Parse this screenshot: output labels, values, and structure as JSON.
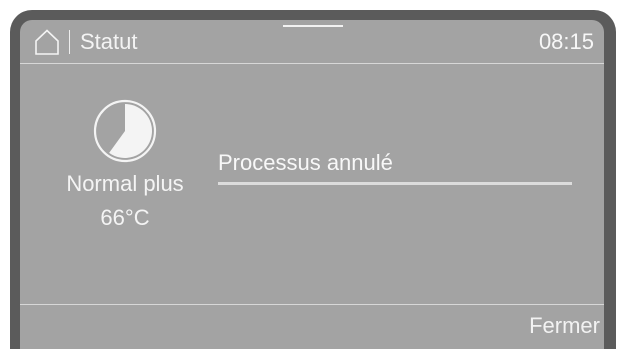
{
  "header": {
    "home_icon": "home-icon",
    "title": "Statut",
    "time": "08:15"
  },
  "program": {
    "icon": "program-progress-pie-icon",
    "progress_fraction": 0.6,
    "name": "Normal plus",
    "temperature": "66°C"
  },
  "status": {
    "message": "Processus annulé",
    "progress": 1.0
  },
  "footer": {
    "close_label": "Fermer"
  },
  "colors": {
    "screen_background": "#a3a3a3",
    "bezel": "#5b5b5b",
    "text": "#f4f4f4"
  }
}
